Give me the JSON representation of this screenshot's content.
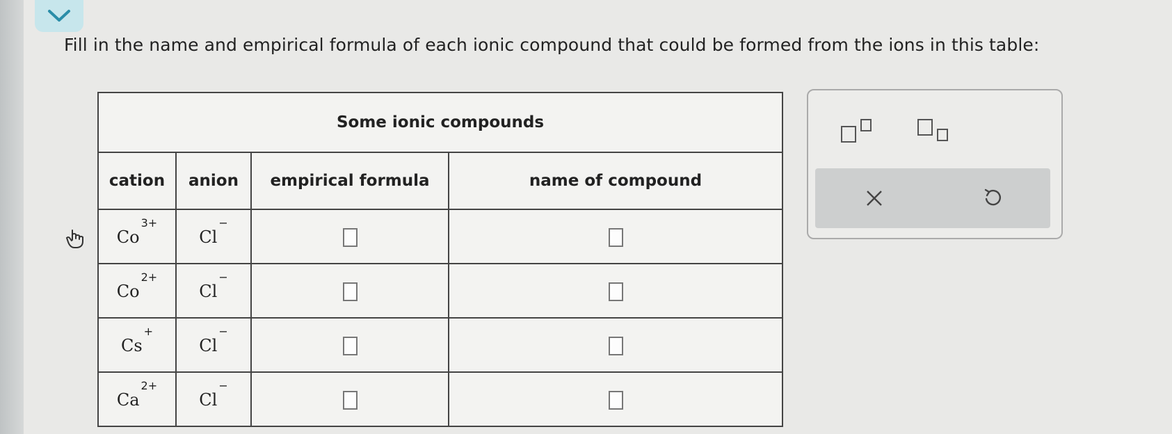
{
  "prompt": "Fill in the name and empirical formula of each ionic compound that could be formed from the ions in this table:",
  "table": {
    "title": "Some ionic compounds",
    "headers": [
      "cation",
      "anion",
      "empirical formula",
      "name of compound"
    ],
    "rows": [
      {
        "cation_symbol": "Co",
        "cation_charge": "3+",
        "anion_symbol": "Cl",
        "anion_charge": "−"
      },
      {
        "cation_symbol": "Co",
        "cation_charge": "2+",
        "anion_symbol": "Cl",
        "anion_charge": "−"
      },
      {
        "cation_symbol": "Cs",
        "cation_charge": "+",
        "anion_symbol": "Cl",
        "anion_charge": "−"
      },
      {
        "cation_symbol": "Ca",
        "cation_charge": "2+",
        "anion_symbol": "Cl",
        "anion_charge": "−"
      }
    ]
  },
  "toolbar": {
    "superscript_icon": "superscript-icon",
    "subscript_icon": "subscript-icon",
    "clear_icon": "close-icon",
    "undo_icon": "undo-icon"
  },
  "colors": {
    "collapse_tab": "#c7e6ec",
    "action_bar": "#cdcfcf"
  }
}
